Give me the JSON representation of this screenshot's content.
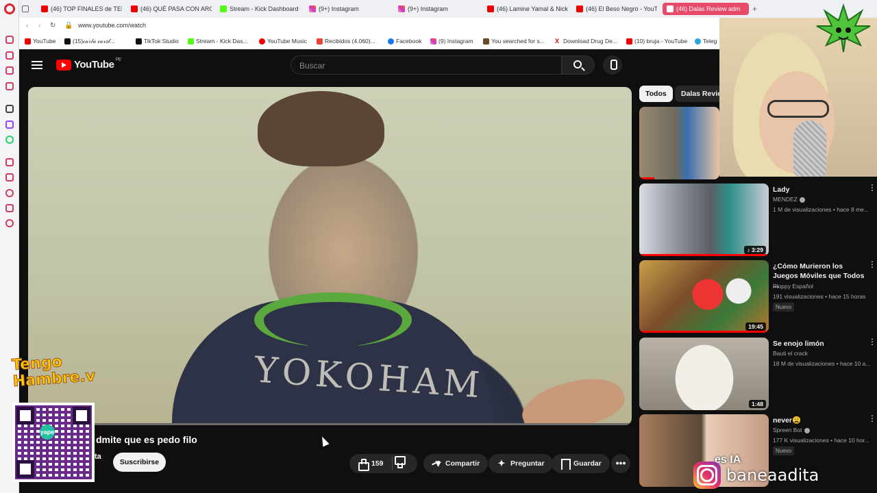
{
  "browser": {
    "tabs": [
      {
        "label": "(46) TOP FINALES de TEMI",
        "favicon": "youtube"
      },
      {
        "label": "(46) QUÉ PASA CON ARGE",
        "favicon": "youtube"
      },
      {
        "label": "Stream - Kick Dashboard",
        "favicon": "kick"
      },
      {
        "label": "(9+) Instagram",
        "favicon": "instagram"
      },
      {
        "label": "(9+) Instagram",
        "favicon": "instagram"
      },
      {
        "label": "(46) Lamine Yamal & Nick",
        "favicon": "youtube"
      },
      {
        "label": "(46) El Beso Negro - YouTu",
        "favicon": "youtube"
      },
      {
        "label": "(46) Dalas Review adm",
        "favicon": "youtube",
        "active": true
      }
    ],
    "new_tab": "+",
    "url": "www.youtube.com/watch",
    "bookmarks": [
      {
        "label": "YouTube",
        "favicon": "youtube"
      },
      {
        "label": "(15)𝒸𝒶𝓇𝓁𝒶 𝒸𝒶𝓇𝑜𝓁...",
        "favicon": "tiktok"
      },
      {
        "label": "TikTok Studio",
        "favicon": "tiktok"
      },
      {
        "label": "Stream - Kick Das...",
        "favicon": "kick"
      },
      {
        "label": "YouTube Music",
        "favicon": "youtube-music"
      },
      {
        "label": "Recibidos (4.060)...",
        "favicon": "gmail"
      },
      {
        "label": "Facebook",
        "favicon": "facebook"
      },
      {
        "label": "(9) Instagram",
        "favicon": "instagram"
      },
      {
        "label": "You searched for s...",
        "favicon": "site"
      },
      {
        "label": "Download Drug De...",
        "favicon": "x"
      },
      {
        "label": "(10) bruja - YouTube",
        "favicon": "youtube"
      },
      {
        "label": "Teleg",
        "favicon": "telegram"
      }
    ]
  },
  "youtube": {
    "logo_text": "YouTube",
    "region": "PE",
    "search_placeholder": "Buscar",
    "video": {
      "title_fragment": "dmite que es pedo filo",
      "channel_fragment": "ta",
      "subscribe_label": "Suscribirse",
      "likes": "159",
      "share_label": "Compartir",
      "ask_label": "Preguntar",
      "save_label": "Guardar",
      "more_label": "•••",
      "frame_text": "YOKOHAM"
    },
    "chips": [
      {
        "label": "Todos",
        "active": true
      },
      {
        "label": "Dalas Review",
        "active": false
      }
    ],
    "recommendations": [
      {
        "title": "",
        "channel": "",
        "meta": "",
        "duration": ""
      },
      {
        "title": "Lady",
        "channel": "MENDEZ",
        "verified": true,
        "meta": "1 M de visualizaciones • hace 8 me...",
        "duration": "♪ 3:29",
        "badge": ""
      },
      {
        "title": "¿Cómo Murieron los Juegos Móviles que Todos ...",
        "channel": "Ploppy Español",
        "meta": "191 visualizaciones • hace 15 horas",
        "duration": "19:45",
        "badge": "Nuevo"
      },
      {
        "title": "Se enojo limón",
        "channel": "Bauti el crack",
        "meta": "18 M de visualizaciones • hace 10 a...",
        "duration": "1:48",
        "badge": ""
      },
      {
        "title": "never😩",
        "channel": "Spreen Bot",
        "verified": true,
        "meta": "177 K visualizaciones • hace 10 hor...",
        "duration": "",
        "badge": "Nuevo",
        "thumb_text": "es IA"
      }
    ]
  },
  "overlays": {
    "brand_line1": "Tengo",
    "brand_line2": "Hambre.v",
    "qr_label": "yape",
    "instagram_handle": "baneaadita"
  },
  "colors": {
    "yt_bg": "#0f0f0f",
    "yt_red": "#ff0000",
    "active_tab": "#e84a6a",
    "brand_yellow": "#ffcc00"
  }
}
